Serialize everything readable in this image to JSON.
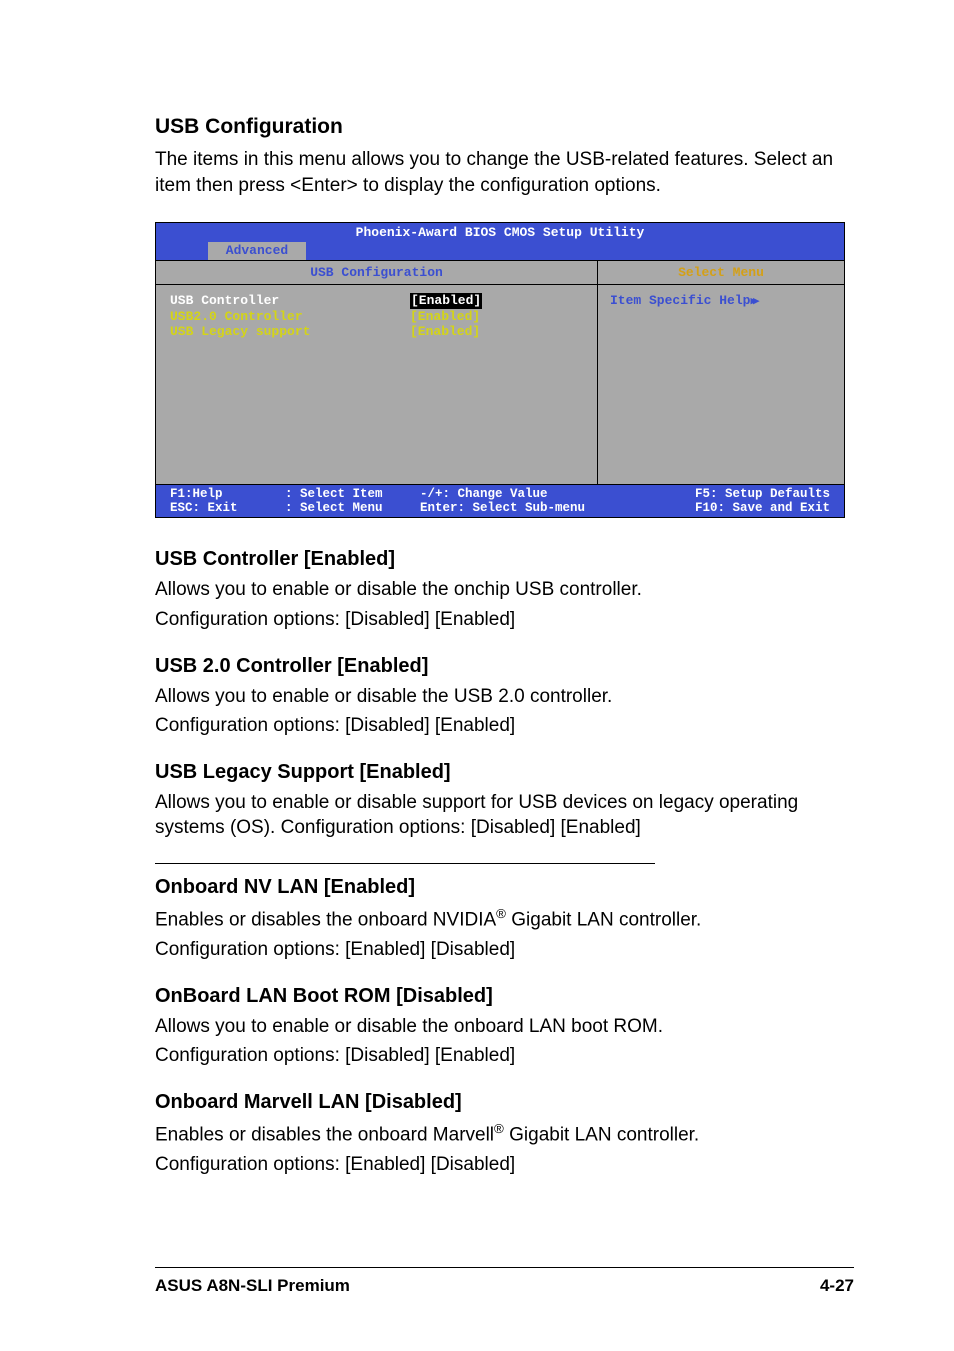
{
  "section1": {
    "title": "USB Configuration",
    "para": "The items in this menu allows you to change the USB-related features. Select an item then press <Enter> to display the configuration options."
  },
  "bios": {
    "title": "Phoenix-Award BIOS CMOS Setup Utility",
    "tab": "Advanced",
    "header_left": "USB Configuration",
    "header_right": "Select Menu",
    "items": [
      {
        "label": "USB Controller",
        "value": "[Enabled]",
        "highlight": true
      },
      {
        "label": "USB2.0 Controller",
        "value": "[Enabled]",
        "highlight": false
      },
      {
        "label": "USB Legacy support",
        "value": "[Enabled]",
        "highlight": false
      }
    ],
    "help_text": "Item Specific Help",
    "footer": {
      "f1": "F1:Help",
      "esc": "ESC: Exit",
      "select_item": ": Select Item",
      "select_menu": ": Select Menu",
      "change_value": "-/+: Change Value",
      "enter_sub": "Enter: Select Sub-menu",
      "f5": "F5: Setup Defaults",
      "f10": "F10: Save and Exit"
    }
  },
  "sections": {
    "usb_controller": {
      "title": "USB Controller [Enabled]",
      "p1": "Allows you to enable or disable the onchip USB controller.",
      "p2": "Configuration options: [Disabled] [Enabled]"
    },
    "usb20": {
      "title": "USB 2.0 Controller [Enabled]",
      "p1": "Allows you to enable or disable the USB 2.0 controller.",
      "p2": "Configuration options: [Disabled] [Enabled]"
    },
    "usb_legacy": {
      "title": "USB Legacy Support [Enabled]",
      "p1": "Allows you to enable or disable support for USB devices on legacy operating systems (OS). Configuration options: [Disabled] [Enabled]"
    },
    "nv_lan": {
      "title": "Onboard NV LAN [Enabled]",
      "p1_pre": "Enables or disables the onboard NVIDIA",
      "p1_post": " Gigabit LAN controller.",
      "p2": "Configuration options: [Enabled] [Disabled]"
    },
    "onboard_lan": {
      "title": "OnBoard LAN Boot ROM [Disabled]",
      "p1": "Allows you to enable or disable the onboard LAN boot ROM.",
      "p2": "Configuration options: [Disabled] [Enabled]"
    },
    "marvell": {
      "title": "Onboard Marvell LAN [Disabled]",
      "p1_pre": "Enables or disables the onboard Marvell",
      "p1_post": " Gigabit LAN controller.",
      "p2": "Configuration options: [Enabled] [Disabled]"
    }
  },
  "footer": {
    "left": "ASUS A8N-SLI Premium",
    "right": "4-27"
  }
}
